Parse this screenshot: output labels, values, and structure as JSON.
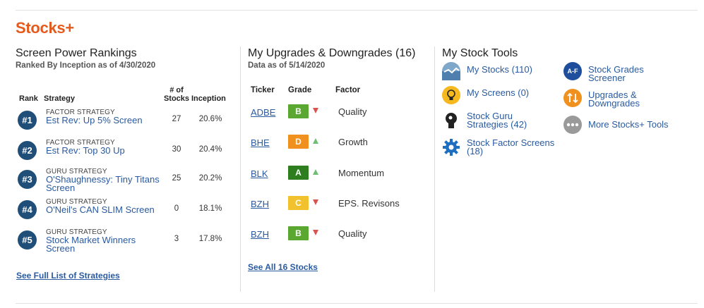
{
  "brand": "Stocks+",
  "rankings": {
    "title": "Screen Power Rankings",
    "subtitle": "Ranked By Inception as of 4/30/2020",
    "headers": {
      "rank": "Rank",
      "strategy": "Strategy",
      "stocks_line1": "# of",
      "stocks_line2": "Stocks",
      "inception": "Inception"
    },
    "rows": [
      {
        "rank": "#1",
        "type": "FACTOR STRATEGY",
        "name": "Est Rev: Up 5% Screen",
        "stocks": "27",
        "inception": "20.6%"
      },
      {
        "rank": "#2",
        "type": "FACTOR STRATEGY",
        "name": "Est Rev: Top 30 Up",
        "stocks": "30",
        "inception": "20.4%"
      },
      {
        "rank": "#3",
        "type": "GURU STRATEGY",
        "name": "O'Shaughnessy: Tiny Titans Screen",
        "stocks": "25",
        "inception": "20.2%"
      },
      {
        "rank": "#4",
        "type": "GURU STRATEGY",
        "name": "O'Neil's CAN SLIM Screen",
        "stocks": "0",
        "inception": "18.1%"
      },
      {
        "rank": "#5",
        "type": "GURU STRATEGY",
        "name": "Stock Market Winners Screen",
        "stocks": "3",
        "inception": "17.8%"
      }
    ],
    "see_all": "See Full List of Strategies"
  },
  "upgrades": {
    "title": "My Upgrades & Downgrades (16)",
    "subtitle": "Data as of 5/14/2020",
    "headers": {
      "ticker": "Ticker",
      "grade": "Grade",
      "factor": "Factor"
    },
    "rows": [
      {
        "ticker": "ADBE",
        "grade": "B",
        "direction": "down",
        "factor": "Quality",
        "color": "#5aa832"
      },
      {
        "ticker": "BHE",
        "grade": "D",
        "direction": "up",
        "factor": "Growth",
        "color": "#f0901e"
      },
      {
        "ticker": "BLK",
        "grade": "A",
        "direction": "up",
        "factor": "Momentum",
        "color": "#2e7d1e"
      },
      {
        "ticker": "BZH",
        "grade": "C",
        "direction": "down",
        "factor": "EPS. Revisons",
        "color": "#f2c12e"
      },
      {
        "ticker": "BZH",
        "grade": "B",
        "direction": "down",
        "factor": "Quality",
        "color": "#5aa832"
      }
    ],
    "see_all": "See All 16 Stocks"
  },
  "tools": {
    "title": "My Stock Tools",
    "items": [
      {
        "line1": "My Stocks (110)",
        "line2": "",
        "icon": "chart-line-icon"
      },
      {
        "line1": "My Screens (0)",
        "line2": "",
        "icon": "lightbulb-icon"
      },
      {
        "line1": "Stock Guru",
        "line2": "Strategies (42)",
        "icon": "guru-head-icon"
      },
      {
        "line1": "Stock Factor Screens",
        "line2": "(18)",
        "icon": "gear-icon"
      },
      {
        "line1": "Stock Grades",
        "line2": "Screener",
        "icon": "grades-af-icon",
        "badge": "A-F"
      },
      {
        "line1": "Upgrades &",
        "line2": "Downgrades",
        "icon": "up-down-arrows-icon"
      },
      {
        "line1": "More Stocks+ Tools",
        "line2": "",
        "icon": "more-dots-icon"
      }
    ]
  },
  "colors": {
    "brand": "#e55a1c",
    "link": "#2a5aa0",
    "rank_badge": "#1f4e79",
    "down": "#d9534f",
    "up": "#6fbf73"
  }
}
